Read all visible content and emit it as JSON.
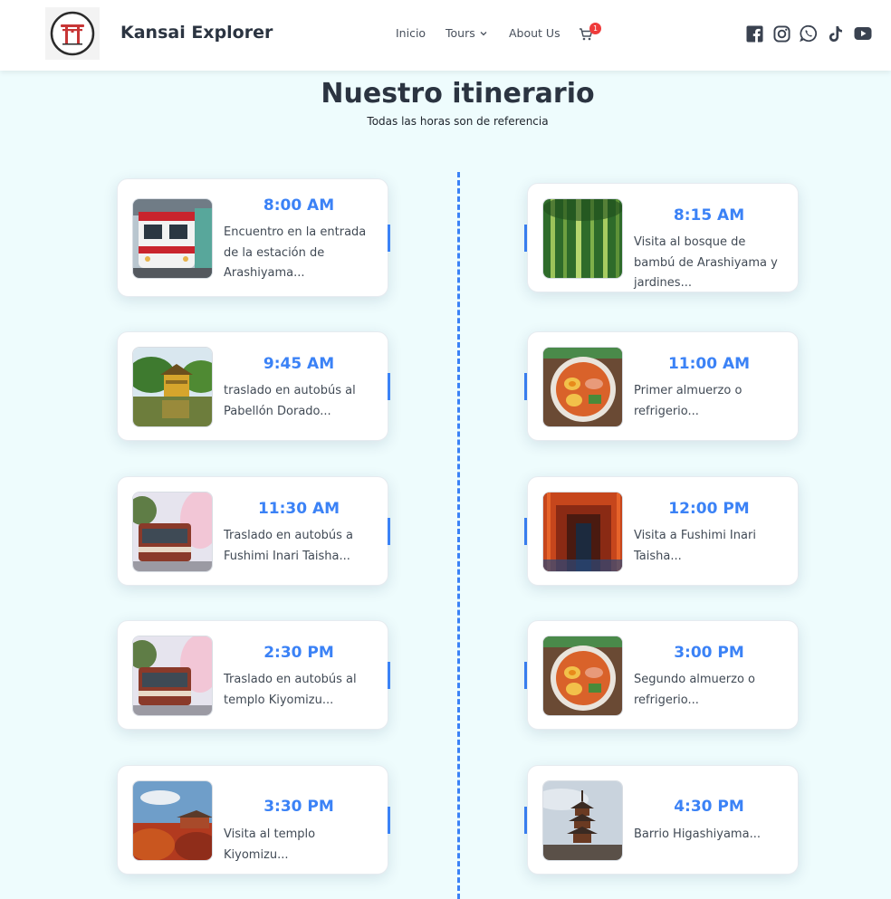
{
  "header": {
    "brand": "Kansai Explorer",
    "nav": {
      "inicio": "Inicio",
      "tours": "Tours",
      "about": "About Us"
    },
    "cart_count": "1",
    "social_icons": [
      "facebook-icon",
      "instagram-icon",
      "whatsapp-icon",
      "tiktok-icon",
      "youtube-icon"
    ]
  },
  "main": {
    "title": "Nuestro itinerario",
    "subtitle": "Todas las horas son de referencia"
  },
  "itinerary": {
    "left": [
      {
        "time": "8:00 AM",
        "desc": "Encuentro en la entrada de la estación de Arashiyama..."
      },
      {
        "time": "9:45 AM",
        "desc": "traslado en autobús al Pabellón Dorado..."
      },
      {
        "time": "11:30 AM",
        "desc": "Traslado en autobús a Fushimi Inari Taisha..."
      },
      {
        "time": "2:30 PM",
        "desc": "Traslado en autobús al templo Kiyomizu..."
      },
      {
        "time": "3:30 PM",
        "desc": "Visita al templo Kiyomizu..."
      }
    ],
    "right": [
      {
        "time": "8:15 AM",
        "desc": "Visita al bosque de bambú de Arashiyama y jardines..."
      },
      {
        "time": "11:00 AM",
        "desc": "Primer almuerzo o refrigerio..."
      },
      {
        "time": "12:00 PM",
        "desc": "Visita a Fushimi Inari Taisha..."
      },
      {
        "time": "3:00 PM",
        "desc": "Segundo almuerzo o refrigerio..."
      },
      {
        "time": "4:30 PM",
        "desc": "Barrio Higashiyama..."
      }
    ]
  },
  "colors": {
    "accent": "#3b82f6",
    "background": "#eefcfd",
    "badge": "#ef3b3b"
  }
}
